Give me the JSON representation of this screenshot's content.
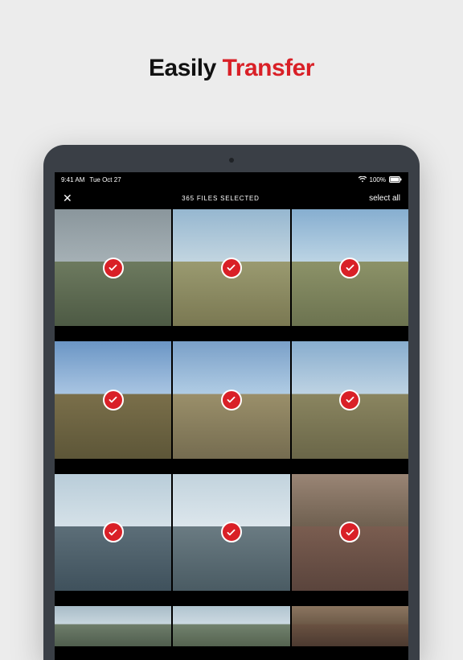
{
  "headline": {
    "word1": "Easily",
    "word2": "Transfer"
  },
  "accent_color": "#d92027",
  "status_bar": {
    "time": "9:41 AM",
    "date": "Tue Oct 27",
    "battery_pct": "100%"
  },
  "header": {
    "close": "✕",
    "title": "365 FILES SELECTED",
    "select_all": "select all"
  },
  "grid": {
    "rows_full": 3,
    "cols": 3,
    "items": [
      {
        "selected": true,
        "scene": "s1"
      },
      {
        "selected": true,
        "scene": "s2"
      },
      {
        "selected": true,
        "scene": "s3"
      },
      {
        "selected": true,
        "scene": "s4"
      },
      {
        "selected": true,
        "scene": "s5"
      },
      {
        "selected": true,
        "scene": "s6"
      },
      {
        "selected": true,
        "scene": "s7"
      },
      {
        "selected": true,
        "scene": "s8"
      },
      {
        "selected": true,
        "scene": "s9"
      },
      {
        "selected": false,
        "scene": "s10",
        "partial": true
      },
      {
        "selected": false,
        "scene": "s11",
        "partial": true
      },
      {
        "selected": false,
        "scene": "s12",
        "partial": true
      }
    ]
  }
}
